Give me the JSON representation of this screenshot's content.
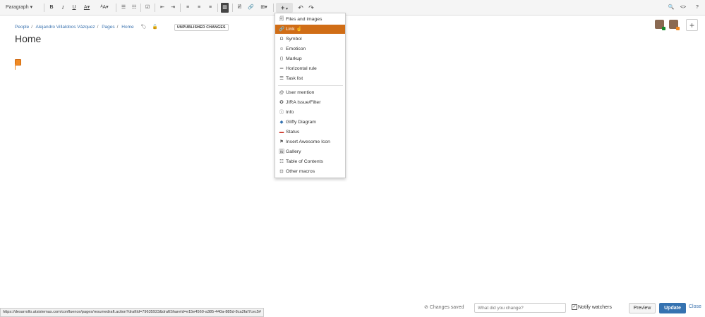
{
  "toolbar": {
    "paragraph": "Paragraph",
    "bold": "B",
    "italic": "I",
    "underline": "U",
    "text_color": "A",
    "font_size": "ᴬA",
    "bullet_list": "☰",
    "numbered_list": "☷",
    "task_list": "☑",
    "outdent": "⇤",
    "indent": "⇥",
    "align_left": "≡",
    "align_center": "≡",
    "align_right": "≡",
    "page_layout": "▥",
    "image": "🖻",
    "link": "🔗",
    "table": "⊞",
    "insert": "+",
    "undo": "↶",
    "redo": "↷",
    "search": "🔍",
    "source": "<>",
    "help": "?"
  },
  "breadcrumb": {
    "items": [
      "People",
      "Alejandro Villalobos Vázquez",
      "Pages",
      "Home"
    ],
    "separator": "/"
  },
  "status_lozenge": "UNPUBLISHED CHANGES",
  "page_title": "Home",
  "insert_menu": {
    "items": [
      {
        "icon": "🗐",
        "label": "Files and images"
      },
      {
        "icon": "🔗",
        "label": "Link"
      },
      {
        "icon": "Ω",
        "label": "Symbol"
      },
      {
        "icon": "☺",
        "label": "Emoticon"
      },
      {
        "icon": "⟨⟩",
        "label": "Markup"
      },
      {
        "icon": "═",
        "label": "Horizontal rule"
      },
      {
        "icon": "☰",
        "label": "Task list"
      },
      {
        "icon": "@",
        "label": "User mention"
      },
      {
        "icon": "✪",
        "label": "JIRA Issue/Filter"
      },
      {
        "icon": "ⓘ",
        "label": "Info"
      },
      {
        "icon": "◆",
        "label": "Gliffy Diagram"
      },
      {
        "icon": "▬",
        "label": "Status"
      },
      {
        "icon": "⚑",
        "label": "Insert Awesome Icon"
      },
      {
        "icon": "🖼",
        "label": "Gallery"
      },
      {
        "icon": "☷",
        "label": "Table of Contents"
      },
      {
        "icon": "⊡",
        "label": "Other macros"
      }
    ]
  },
  "footer": {
    "saved": "Changes saved",
    "change_placeholder": "What did you change?",
    "notify": "Notify watchers",
    "notify_check": "✓",
    "preview": "Preview",
    "update": "Update",
    "close": "Close"
  },
  "status_url": "https://desarrollo.atsistemas.com/confluence/pages/resumedraft.action?draftId=79635923&draftShareId=e15e4560-a385-440a-885d-8ca2faf7cec5#",
  "colors": {
    "accent": "#3572b0",
    "menu_highlight": "#d06d16",
    "avatar_badge_1": "#14892c",
    "avatar_badge_2": "#f08a24"
  }
}
